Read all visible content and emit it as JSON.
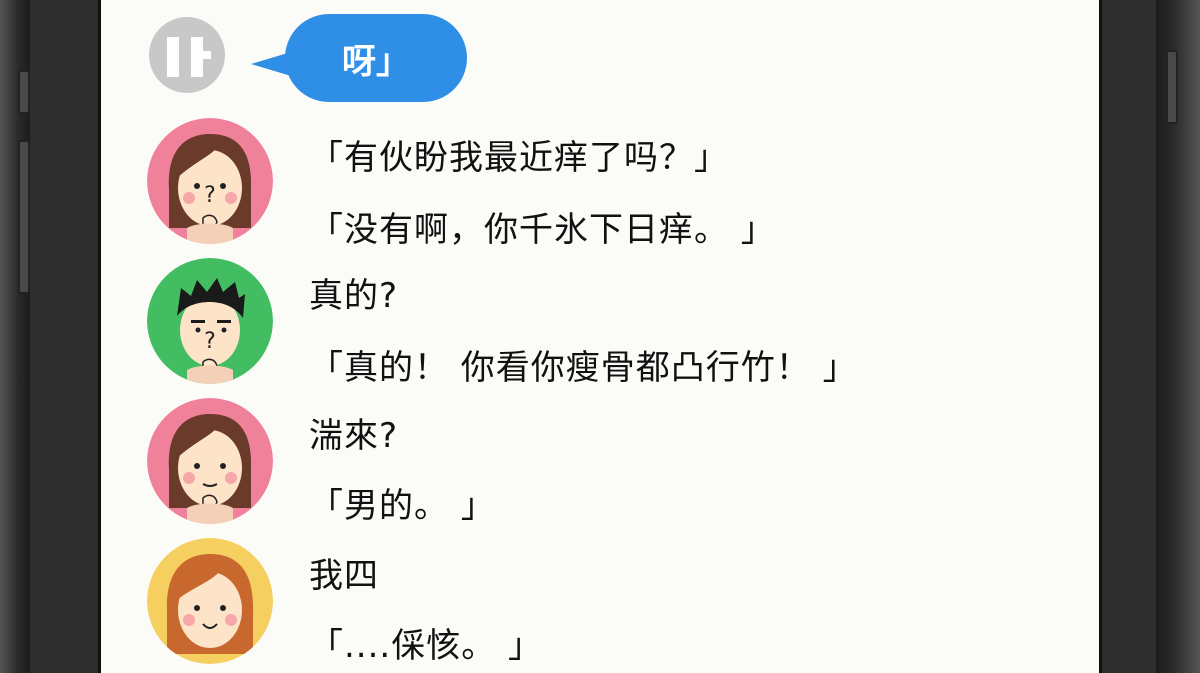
{
  "chat": {
    "partial_avatar_glyph": "ㅑ",
    "bubble_text": "呀」",
    "messages": [
      {
        "avatar": "girl-brown-thinking",
        "lines": [
          "「有伙盼我最近痒了吗？」",
          "「没有啊，你千氷下日痒。 」"
        ]
      },
      {
        "avatar": "boy-thinking",
        "lines": [
          "真的?",
          "「真的！ 你看你瘦骨都凸行竹！ 」"
        ]
      },
      {
        "avatar": "girl-brown-thinking-2",
        "lines": [
          "湍來?",
          "「男的。 」"
        ]
      },
      {
        "avatar": "girl-orange-smiling",
        "lines": [
          "我四",
          "「....倸㤥。 」"
        ]
      }
    ]
  },
  "colors": {
    "bubble": "#2f8fe6",
    "avatar_pink": "#f0819a",
    "avatar_green": "#43bd61",
    "avatar_yellow": "#f5cf5f"
  }
}
